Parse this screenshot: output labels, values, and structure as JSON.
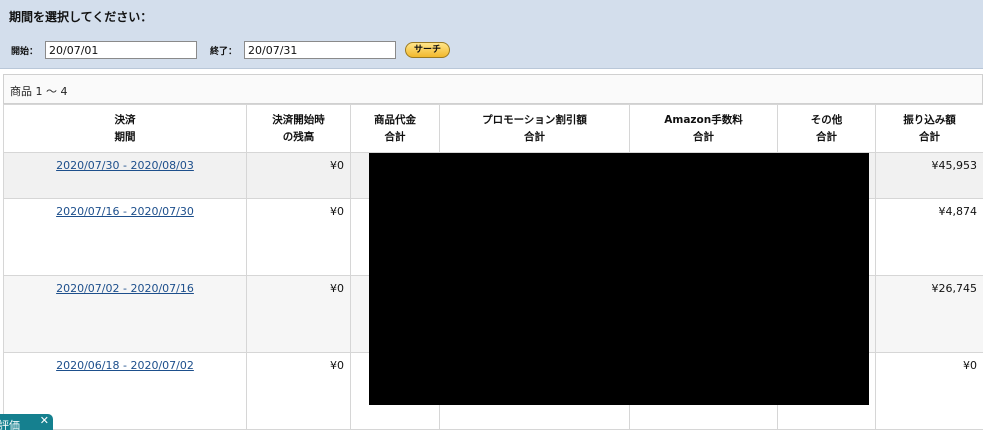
{
  "filter": {
    "title": "期間を選択してください：",
    "start_label": "開始：",
    "start_value": "20/07/01",
    "end_label": "終了：",
    "end_value": "20/07/31",
    "search_label": "サーチ"
  },
  "results": {
    "count_text": "商品 1 〜 4"
  },
  "table": {
    "headers": [
      {
        "line1": "決済",
        "line2": "期間"
      },
      {
        "line1": "決済開始時",
        "line2": "の残高"
      },
      {
        "line1": "商品代金",
        "line2": "合計"
      },
      {
        "line1": "プロモーション割引額",
        "line2": "合計"
      },
      {
        "line1": "Amazon手数料",
        "line2": "合計"
      },
      {
        "line1": "その他",
        "line2": "合計"
      },
      {
        "line1": "振り込み額",
        "line2": "合計"
      }
    ],
    "rows": [
      {
        "period": "2020/07/30 - 2020/08/03",
        "opening_balance": "¥0",
        "payout": "¥45,953"
      },
      {
        "period": "2020/07/16 - 2020/07/30",
        "opening_balance": "¥0",
        "payout": "¥4,874"
      },
      {
        "period": "2020/07/02 - 2020/07/16",
        "opening_balance": "¥0",
        "payout": "¥26,745"
      },
      {
        "period": "2020/06/18 - 2020/07/02",
        "opening_balance": "¥0",
        "payout": "¥0"
      }
    ]
  },
  "feedback": {
    "label": "評価",
    "close": "✕"
  },
  "colors": {
    "filter_bg": "#d3deec",
    "link": "#1d4f8c",
    "button": "#f2b82c",
    "feedback_tab": "#15808f",
    "redaction": "#000000"
  }
}
